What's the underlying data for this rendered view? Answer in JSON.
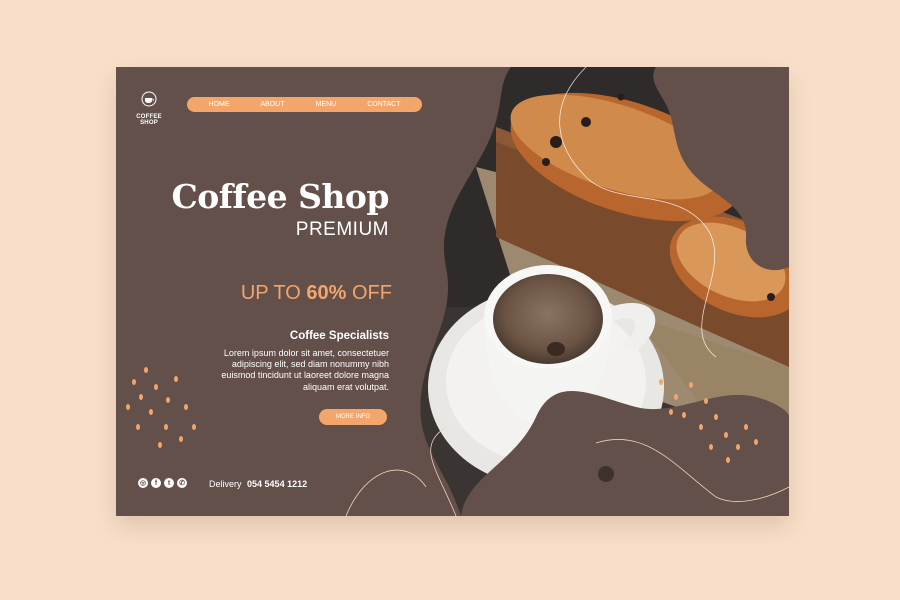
{
  "logo": {
    "line1": "COFFEE",
    "line2": "SHOP"
  },
  "nav": [
    {
      "label": "HOME"
    },
    {
      "label": "ABOUT"
    },
    {
      "label": "MENU"
    },
    {
      "label": "CONTACT"
    }
  ],
  "hero": {
    "title": "Coffee Shop",
    "subtitle": "PREMIUM",
    "discount_prefix": "UP TO",
    "discount_value": "60%",
    "discount_suffix": "OFF",
    "specialists_title": "Coffee Specialists",
    "specialists_text": "Lorem ipsum dolor sit amet, consectetuer adipiscing elit, sed diam nonummy nibh euismod tincidunt ut laoreet dolore magna aliquam erat volutpat.",
    "cta_label": "MORE INFO"
  },
  "footer": {
    "delivery_label": "Delivery",
    "delivery_number": "054 5454 1212",
    "social_icons": [
      "instagram-icon",
      "facebook-icon",
      "twitter-icon",
      "whatsapp-icon"
    ]
  },
  "colors": {
    "background": "#f9dfc9",
    "card": "#63504b",
    "accent": "#f2a66b",
    "text": "#ffffff"
  }
}
